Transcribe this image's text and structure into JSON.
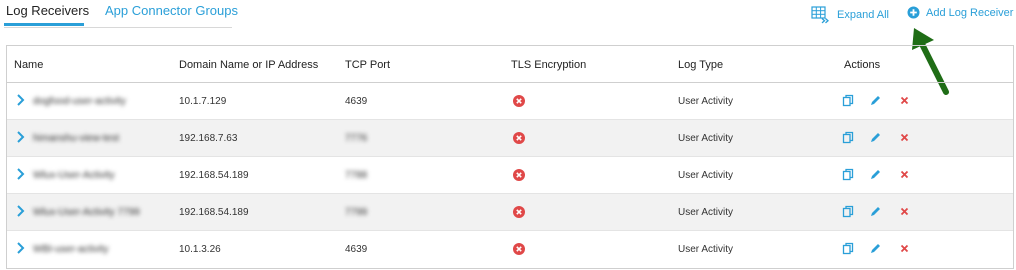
{
  "tabs": [
    {
      "label": "Log Receivers",
      "active": true
    },
    {
      "label": "App Connector Groups",
      "active": false
    }
  ],
  "toolbar": {
    "expand_all_label": "Expand All",
    "expand_all_icon": "grid-expand-icon",
    "add_label": "Add Log Receiver",
    "add_icon": "plus-circle-icon"
  },
  "colors": {
    "accent": "#2a9fd8",
    "error": "#e04848",
    "annotation": "#1f6d16"
  },
  "table": {
    "headers": [
      "Name",
      "Domain Name or IP Address",
      "TCP Port",
      "TLS Encryption",
      "Log Type",
      "Actions"
    ],
    "rows": [
      {
        "name": "dogfood-user-activity",
        "domain": "10.1.7.129",
        "port": "4639",
        "tls": false,
        "log_type": "User Activity"
      },
      {
        "name": "himanshu-view-test",
        "domain": "192.168.7.63",
        "port": "7776",
        "tls": false,
        "log_type": "User Activity"
      },
      {
        "name": "Wlux-User-Activity",
        "domain": "192.168.54.189",
        "port": "7788",
        "tls": false,
        "log_type": "User Activity"
      },
      {
        "name": "Wlux-User-Activity 7799",
        "domain": "192.168.54.189",
        "port": "7799",
        "tls": false,
        "log_type": "User Activity"
      },
      {
        "name": "WBI-user-activity",
        "domain": "10.1.3.26",
        "port": "4639",
        "tls": false,
        "log_type": "User Activity"
      }
    ],
    "row_actions": [
      "copy-icon",
      "edit-pencil-icon",
      "delete-x-icon"
    ]
  }
}
